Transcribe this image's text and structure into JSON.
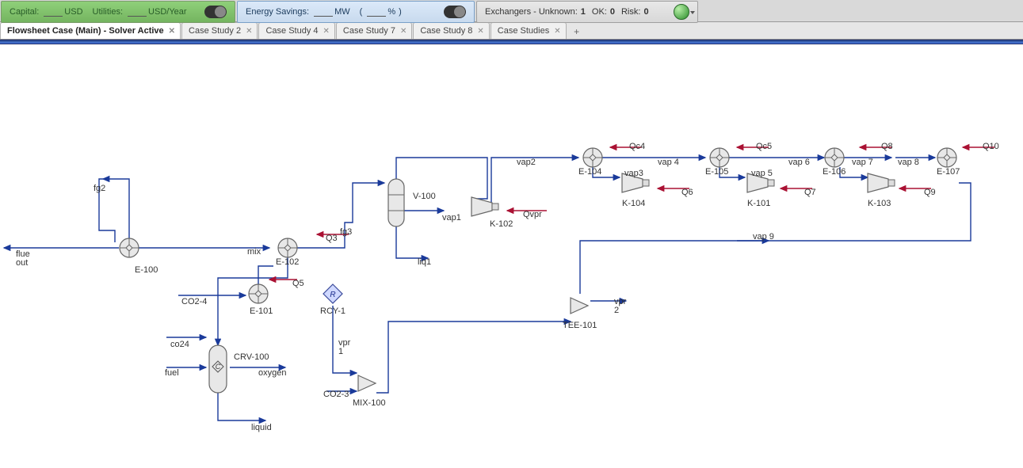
{
  "topbar": {
    "pill1": {
      "capital_label": "Capital:",
      "capital_unit": "USD",
      "utilities_label": "Utilities:",
      "utilities_unit": "USD/Year"
    },
    "pill2": {
      "energy_label": "Energy Savings:",
      "mw": "MW",
      "pct": "%"
    },
    "pill3": {
      "exch_label": "Exchangers - Unknown:",
      "exch_val": "1",
      "ok_label": "OK:",
      "ok_val": "0",
      "risk_label": "Risk:",
      "risk_val": "0"
    }
  },
  "tabs": {
    "t0": "Flowsheet Case (Main) - Solver Active",
    "t1": "Case Study 2",
    "t2": "Case Study 4",
    "t3": "Case Study 7",
    "t4": "Case Study 8",
    "t5": "Case Studies"
  },
  "units": {
    "e100": "E-100",
    "e101": "E-101",
    "e102": "E-102",
    "e104": "E-104",
    "e105": "E-105",
    "e106": "E-106",
    "e107": "E-107",
    "crv100": "CRV-100",
    "rcy1": "RCY-1",
    "mix100": "MIX-100",
    "v100": "V-100",
    "tee101": "TEE-101",
    "k101": "K-101",
    "k102": "K-102",
    "k103": "K-103",
    "k104": "K-104"
  },
  "streams": {
    "flue_out": "flue\nout",
    "fg2": "fg2",
    "fg3": "fg3",
    "mix": "mix",
    "co24": "co24",
    "co2_4": "CO2-4",
    "fuel": "fuel",
    "oxygen": "oxygen",
    "liquid": "liquid",
    "co2_3": "CO2-3",
    "vpr1": "vpr\n1",
    "vpr2": "vpr\n2",
    "liq1": "liq1",
    "vap1": "vap1",
    "vap2": "vap2",
    "vap3": "vap3",
    "vap4": "vap 4",
    "vap5": "vap 5",
    "vap6": "vap 6",
    "vap7": "vap 7",
    "vap8": "vap 8",
    "vap9": "vap 9"
  },
  "energy": {
    "q3": "Q3",
    "q5": "Q5",
    "q6": "Q6",
    "q7": "Q7",
    "q8": "Q8",
    "q9": "Q9",
    "q10": "Q10",
    "qc4": "Qc4",
    "qc5": "Qc5",
    "qvpr": "Qvpr"
  }
}
